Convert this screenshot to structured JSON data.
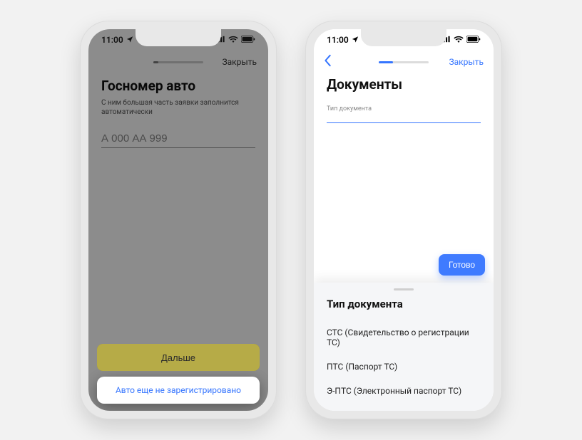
{
  "status": {
    "time": "11:00",
    "location_glyph": "➤",
    "signal_glyph": "▮▮▮▮",
    "wifi_glyph": "✶",
    "battery_glyph": "▮▮"
  },
  "screen1": {
    "close_label": "Закрыть",
    "title": "Госномер авто",
    "subtitle": "С ним большая часть заявки заполнится автоматически",
    "input_placeholder": "А 000 АА 999",
    "input_value": "",
    "primary_button": "Дальше",
    "sheet_option": "Авто еще не зарегистрировано",
    "progress_pct": "10%"
  },
  "screen2": {
    "close_label": "Закрыть",
    "title": "Документы",
    "field_label": "Тип документа",
    "done_label": "Готово",
    "picker_title": "Тип документа",
    "options": [
      "СТС (Свидетельство о регистрации ТС)",
      "ПТС (Паспорт ТС)",
      "Э-ПТС (Электронный паспорт ТС)"
    ],
    "progress_pct": "28%"
  }
}
